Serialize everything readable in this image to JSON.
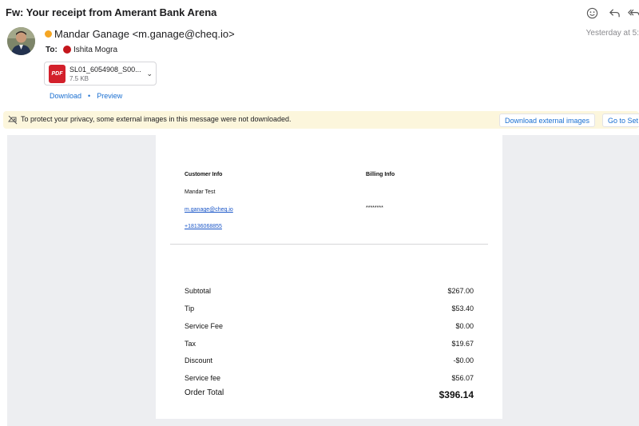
{
  "email": {
    "subject": "Fw: Your receipt from Amerant Bank Arena",
    "sender": "Mandar Ganage <m.ganage@cheq.io>",
    "timestamp": "Yesterday at 5:",
    "to_label": "To:",
    "recipient": "Ishita Mogra"
  },
  "attachment": {
    "name": "SL01_6054908_S00...",
    "size": "7.5 KB",
    "icon_label": "PDF",
    "download_label": "Download",
    "separator": "•",
    "preview_label": "Preview"
  },
  "privacy": {
    "message": "To protect your privacy, some external images in this message were not downloaded.",
    "download_button": "Download external images",
    "settings_button": "Go to Set"
  },
  "receipt": {
    "customer_info_header": "Customer Info",
    "billing_info_header": "Billing Info",
    "customer_name": "Mandar Test",
    "customer_email": "m.ganage@cheq.io",
    "customer_phone": "+18136068855",
    "billing_masked": "********",
    "rows": [
      {
        "label": "Subtotal",
        "value": "$267.00"
      },
      {
        "label": "Tip",
        "value": "$53.40"
      },
      {
        "label": "Service Fee",
        "value": "$0.00"
      },
      {
        "label": "Tax",
        "value": "$19.67"
      },
      {
        "label": "Discount",
        "value": "-$0.00"
      },
      {
        "label": "Service fee",
        "value": "$56.07"
      }
    ],
    "total_label": "Order Total",
    "total_value": "$396.14"
  },
  "icons": {
    "emoji": "smiley-icon",
    "reply": "reply-icon",
    "reply_all": "reply-all-icon",
    "unread_status": "status-dot-icon",
    "recipient_avatar": "recipient-avatar-icon",
    "attachment_menu": "chevron-down-icon",
    "privacy": "privacy-icon"
  },
  "colors": {
    "accent": "#1a6fd1",
    "privacy_bar": "#fcf6dc",
    "pdf_red": "#d3202b",
    "status_orange": "#f5a623",
    "recipient_red": "#c4161c",
    "body_background": "#edeef1"
  }
}
